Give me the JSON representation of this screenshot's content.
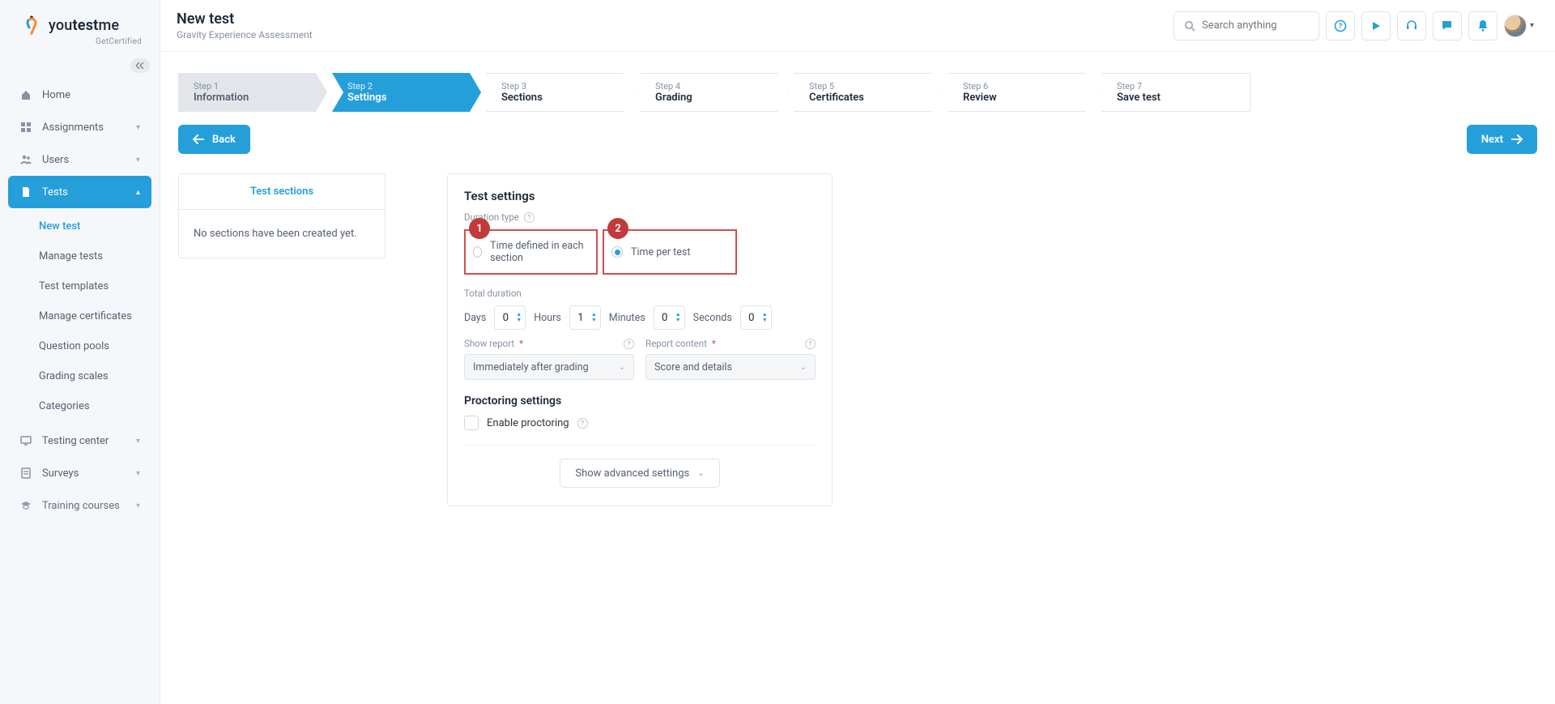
{
  "logo": {
    "brand": "youtestme",
    "sub": "GetCertified"
  },
  "header": {
    "title": "New test",
    "subtitle": "Gravity Experience Assessment",
    "search_placeholder": "Search anything"
  },
  "sidebar": {
    "items": [
      {
        "label": "Home"
      },
      {
        "label": "Assignments"
      },
      {
        "label": "Users"
      },
      {
        "label": "Tests"
      },
      {
        "label": "Testing center"
      },
      {
        "label": "Surveys"
      },
      {
        "label": "Training courses"
      }
    ],
    "tests_sub": [
      {
        "label": "New test"
      },
      {
        "label": "Manage tests"
      },
      {
        "label": "Test templates"
      },
      {
        "label": "Manage certificates"
      },
      {
        "label": "Question pools"
      },
      {
        "label": "Grading scales"
      },
      {
        "label": "Categories"
      }
    ]
  },
  "wizard": {
    "steps": [
      {
        "num": "Step 1",
        "label": "Information"
      },
      {
        "num": "Step 2",
        "label": "Settings"
      },
      {
        "num": "Step 3",
        "label": "Sections"
      },
      {
        "num": "Step 4",
        "label": "Grading"
      },
      {
        "num": "Step 5",
        "label": "Certificates"
      },
      {
        "num": "Step 6",
        "label": "Review"
      },
      {
        "num": "Step 7",
        "label": "Save test"
      }
    ],
    "back": "Back",
    "next": "Next"
  },
  "sections_panel": {
    "tab": "Test sections",
    "empty": "No sections have been created yet."
  },
  "settings": {
    "heading": "Test settings",
    "duration_type_label": "Duration type",
    "radios": {
      "section": "Time defined in each section",
      "test": "Time per test"
    },
    "badges": {
      "one": "1",
      "two": "2"
    },
    "total_duration_label": "Total duration",
    "duration": {
      "days_label": "Days",
      "days_value": "0",
      "hours_label": "Hours",
      "hours_value": "1",
      "minutes_label": "Minutes",
      "minutes_value": "0",
      "seconds_label": "Seconds",
      "seconds_value": "0"
    },
    "show_report_label": "Show report",
    "show_report_value": "Immediately after grading",
    "report_content_label": "Report content",
    "report_content_value": "Score and details",
    "proctoring_heading": "Proctoring settings",
    "enable_proctoring": "Enable proctoring",
    "advanced": "Show advanced settings"
  }
}
